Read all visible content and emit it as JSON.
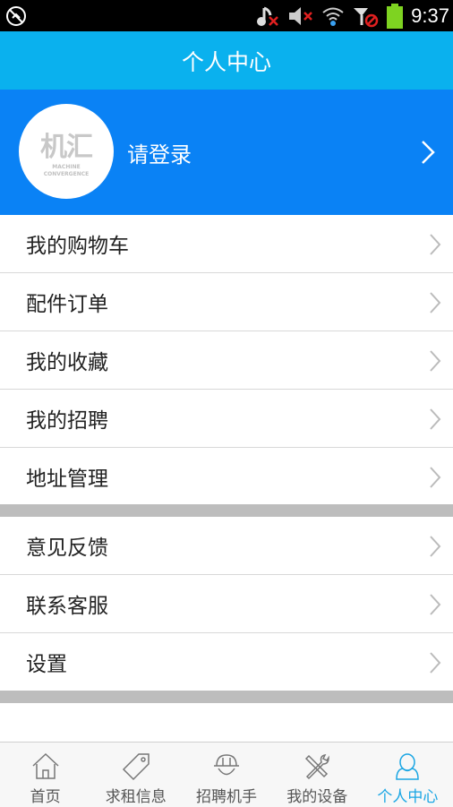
{
  "status_bar": {
    "time": "9:37",
    "icons": [
      "no-sync-icon",
      "music-muted-icon",
      "volume-muted-icon",
      "wifi-icon",
      "signal-blocked-icon",
      "battery-icon"
    ]
  },
  "header": {
    "title": "个人中心"
  },
  "profile": {
    "logo_text": "机汇",
    "logo_subtext_1": "MACHINE",
    "logo_subtext_2": "CONVERGENCE",
    "login_label": "请登录"
  },
  "menu_group_1": [
    {
      "label": "我的购物车"
    },
    {
      "label": "配件订单"
    },
    {
      "label": "我的收藏"
    },
    {
      "label": "我的招聘"
    },
    {
      "label": "地址管理"
    }
  ],
  "menu_group_2": [
    {
      "label": "意见反馈"
    },
    {
      "label": "联系客服"
    },
    {
      "label": "设置"
    }
  ],
  "tabbar": {
    "tabs": [
      {
        "label": "首页",
        "icon": "home-icon"
      },
      {
        "label": "求租信息",
        "icon": "tag-icon"
      },
      {
        "label": "招聘机手",
        "icon": "helmet-icon"
      },
      {
        "label": "我的设备",
        "icon": "tools-icon"
      },
      {
        "label": "个人中心",
        "icon": "user-icon"
      }
    ],
    "active_index": 4,
    "active_color": "#1aa6e4"
  },
  "colors": {
    "header": "#0ab1ee",
    "profile_bg": "#0a82f5"
  }
}
